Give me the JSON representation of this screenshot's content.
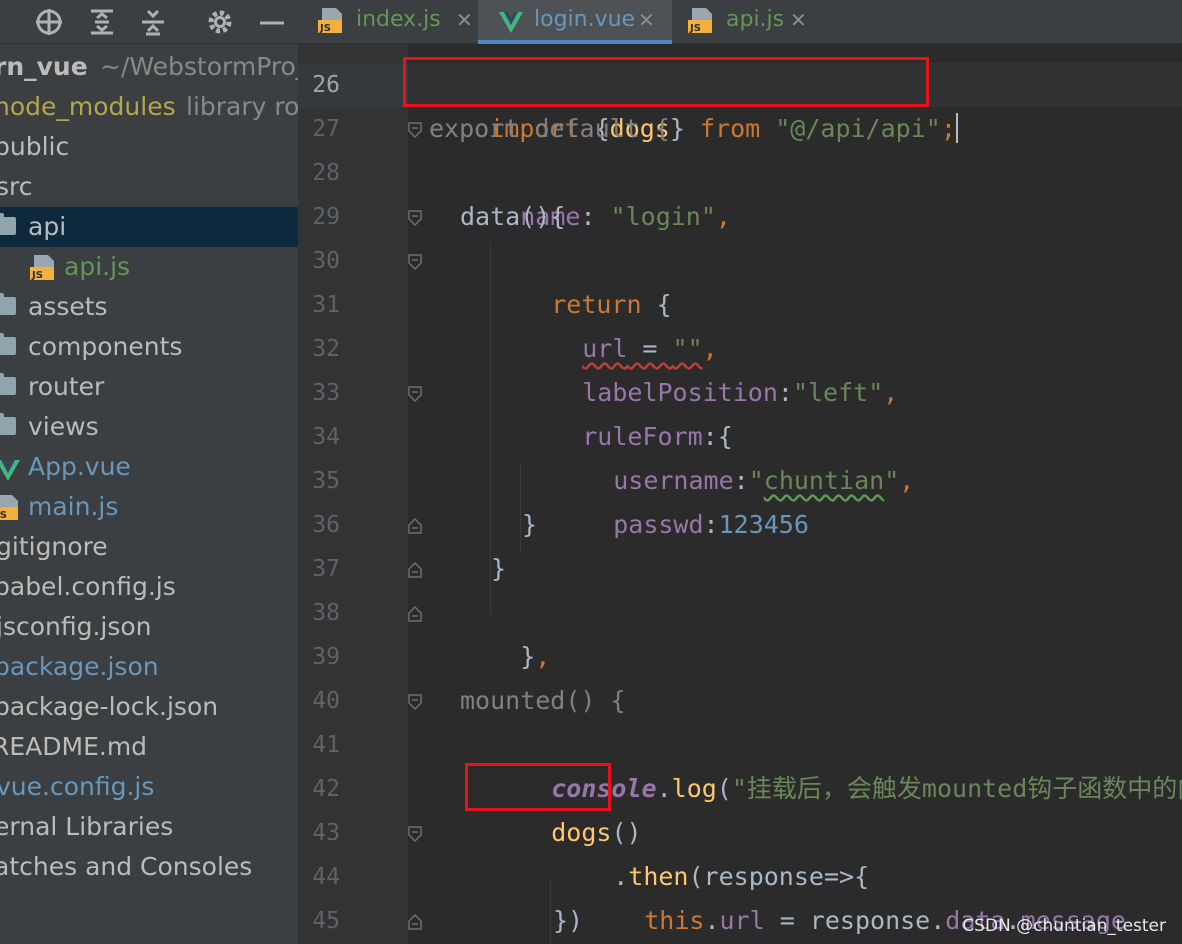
{
  "sidebar": {
    "toolbar": [
      "crosshair-icon",
      "expand-all-icon",
      "collapse-all-icon",
      "gear-icon",
      "minimize-icon"
    ],
    "project_name": "rn_vue",
    "project_path": "~/WebstormProj",
    "items": [
      {
        "label": "node_modules",
        "hint": "library ro"
      },
      {
        "label": "public"
      },
      {
        "label": "src"
      },
      {
        "label": "api"
      },
      {
        "label": "api.js"
      },
      {
        "label": "assets"
      },
      {
        "label": "components"
      },
      {
        "label": "router"
      },
      {
        "label": "views"
      },
      {
        "label": "App.vue"
      },
      {
        "label": "main.js"
      },
      {
        "label": "gitignore"
      },
      {
        "label": "babel.config.js"
      },
      {
        "label": "jsconfig.json"
      },
      {
        "label": "package.json"
      },
      {
        "label": "package-lock.json"
      },
      {
        "label": "README.md"
      },
      {
        "label": "vue.config.js"
      },
      {
        "label": "ernal Libraries"
      },
      {
        "label": "atches and Consoles"
      }
    ]
  },
  "tabs": [
    {
      "label": "index.js",
      "close": "✕",
      "icon": "js-icon"
    },
    {
      "label": "login.vue",
      "close": "✕",
      "icon": "vue-icon",
      "active": true
    },
    {
      "label": "api.js",
      "close": "✕",
      "icon": "js-icon"
    }
  ],
  "editor": {
    "line_numbers": [
      "26",
      "27",
      "28",
      "29",
      "30",
      "31",
      "32",
      "33",
      "34",
      "35",
      "36",
      "37",
      "38",
      "39",
      "40",
      "41",
      "42",
      "43",
      "44",
      "45"
    ],
    "lines": {
      "l26": {
        "import": "import",
        "brace_open": " {",
        "dogs": "dogs",
        "brace_close": "}",
        "from": " from ",
        "path": "\"@/api/api\"",
        "semi": ";"
      },
      "l27": {
        "text": "export default {"
      },
      "l28": {
        "key": "name",
        "colon": ": ",
        "value": "\"login\"",
        "comma": ","
      },
      "l29": {
        "text": "data(){"
      },
      "l30": {
        "kw": "return",
        "brace": " {"
      },
      "l31": {
        "key": "url",
        "eq": " = ",
        "value": "\"\"",
        "comma": ","
      },
      "l32": {
        "key": "labelPosition",
        "colon": ":",
        "value": "\"left\"",
        "comma": ","
      },
      "l33": {
        "key": "ruleForm",
        "rest": ":{"
      },
      "l34": {
        "key": "username",
        "colon": ":",
        "q1": "\"",
        "value": "chuntian",
        "q2": "\"",
        "comma": ","
      },
      "l35": {
        "key": "passwd",
        "colon": ":",
        "value": "123456"
      },
      "l36": {
        "text": "}"
      },
      "l37": {
        "text": "}"
      },
      "l38": {
        "brace": "}",
        "comma": ","
      },
      "l40": {
        "text": "mounted() {"
      },
      "l41": {
        "obj": "console",
        "dot": ".",
        "method": "log",
        "paren": "(",
        "value": "\"挂载后，会触发mounted钩子函数中的内容"
      },
      "l42": {
        "fn": "dogs",
        "paren": "()"
      },
      "l43": {
        "dot": ".",
        "method": "then",
        "rest": "(response=>{"
      },
      "l44": {
        "kw": "this",
        "dot": ".",
        "prop1": "url",
        "eq": " = response.",
        "prop2": "data",
        "dot2": ".",
        "prop3": "message"
      },
      "l45": {
        "text": "})"
      }
    }
  },
  "watermark": "CSDN @chuntian_tester",
  "colors": {
    "keyword": "#cc7832",
    "string": "#6a8759",
    "property": "#9876aa",
    "number": "#6897bb",
    "function": "#ffc66d",
    "highlight_box": "#e8131b",
    "accent": "#4a88c7"
  }
}
